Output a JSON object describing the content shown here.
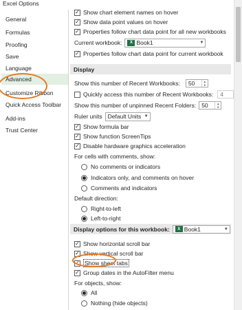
{
  "window": {
    "title": "Excel Options"
  },
  "sidebar": {
    "items": [
      {
        "label": "General"
      },
      {
        "label": "Formulas"
      },
      {
        "label": "Proofing"
      },
      {
        "label": "Save"
      },
      {
        "label": "Language"
      },
      {
        "label": "Advanced"
      },
      {
        "label": "Customize Ribbon"
      },
      {
        "label": "Quick Access Toolbar"
      },
      {
        "label": "Add-ins"
      },
      {
        "label": "Trust Center"
      }
    ]
  },
  "chart": {
    "show_element_names": "Show chart element names on hover",
    "show_data_point_values": "Show data point values on hover",
    "properties_all": "Properties follow chart data point for all new workbooks",
    "current_workbook_label": "Current workbook:",
    "current_workbook_value": "Book1",
    "properties_current": "Properties follow chart data point for current workbook"
  },
  "display": {
    "header": "Display",
    "recent_workbooks_label": "Show this number of Recent Workbooks:",
    "recent_workbooks_value": "50",
    "quick_access_label": "Quickly access this number of Recent Workbooks:",
    "quick_access_value": "4",
    "unpinned_folders_label": "Show this number of unpinned Recent Folders:",
    "unpinned_folders_value": "50",
    "ruler_units_label": "Ruler units",
    "ruler_units_value": "Default Units",
    "show_formula_bar": "Show formula bar",
    "show_function_screentips": "Show function ScreenTips",
    "disable_hw_accel": "Disable hardware graphics acceleration",
    "comments_label": "For cells with comments, show:",
    "comments_none": "No comments or indicators",
    "comments_indicators": "Indicators only, and comments on hover",
    "comments_both": "Comments and indicators",
    "direction_label": "Default direction:",
    "direction_rtl": "Right-to-left",
    "direction_ltr": "Left-to-right"
  },
  "workbook_display": {
    "header": "Display options for this workbook:",
    "workbook_value": "Book1",
    "show_hscroll": "Show horizontal scroll bar",
    "show_vscroll": "Show vertical scroll bar",
    "show_sheet_tabs": "Show sheet tabs",
    "group_dates": "Group dates in the AutoFilter menu",
    "objects_label": "For objects, show:",
    "objects_all": "All",
    "objects_nothing": "Nothing (hide objects)"
  },
  "icons": {
    "check": "✓",
    "excel": "X"
  },
  "colors": {
    "highlight": "#e87722",
    "active_nav": "#e2efe3",
    "section_bg": "#e8e8e8",
    "excel_green": "#1e7145"
  }
}
